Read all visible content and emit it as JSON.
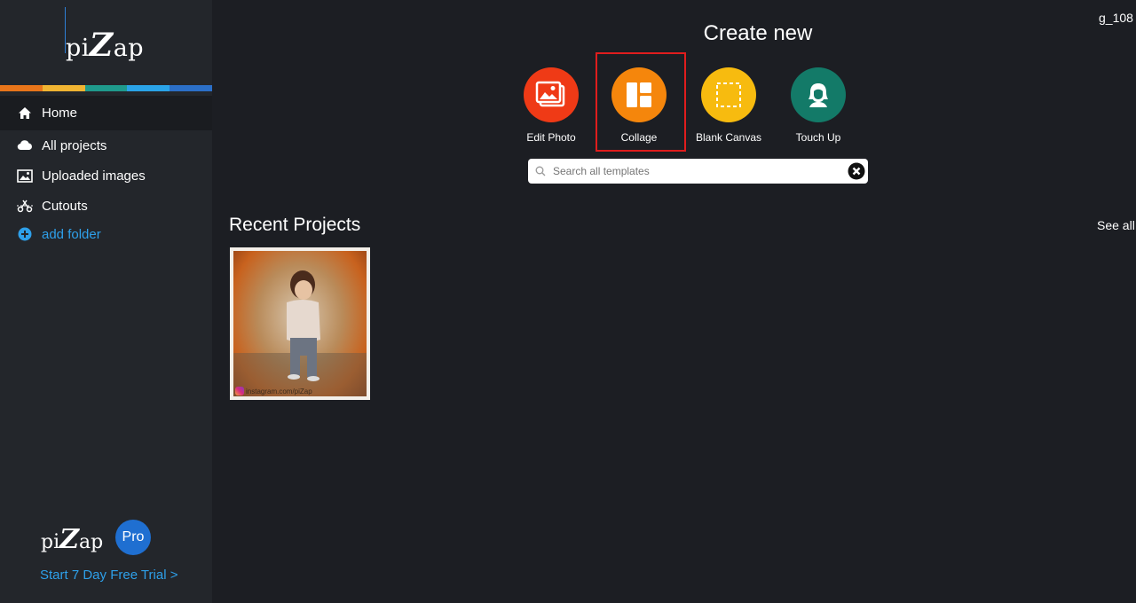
{
  "sidebar": {
    "logo": {
      "pre": "pi",
      "z": "Z",
      "post": "ap"
    },
    "stripe_colors": [
      "#e8751a",
      "#f0b432",
      "#1f9a8c",
      "#2aa3e8",
      "#2b6fc7"
    ],
    "items": [
      {
        "label": "Home",
        "icon": "home-icon"
      },
      {
        "label": "All projects",
        "icon": "cloud-icon"
      },
      {
        "label": "Uploaded images",
        "icon": "image-icon"
      },
      {
        "label": "Cutouts",
        "icon": "scissors-icon"
      },
      {
        "label": "add folder",
        "icon": "plus-circle-icon"
      }
    ],
    "pro": {
      "pre": "pi",
      "z": "Z",
      "post": "ap",
      "badge": "Pro",
      "trial_link": "Start 7 Day Free Trial >"
    }
  },
  "header": {
    "user": "g_108",
    "create_title": "Create new"
  },
  "create_options": [
    {
      "label": "Edit Photo",
      "color": "#ef3a16",
      "icon": "edit-photo-icon"
    },
    {
      "label": "Collage",
      "color": "#f5860c",
      "icon": "collage-icon"
    },
    {
      "label": "Blank Canvas",
      "color": "#f7bb0f",
      "icon": "blank-canvas-icon"
    },
    {
      "label": "Touch Up",
      "color": "#137a68",
      "icon": "touch-up-icon"
    }
  ],
  "search": {
    "placeholder": "Search all templates"
  },
  "recent": {
    "title": "Recent Projects",
    "see_all": "See all",
    "projects": [
      {
        "watermark": "instagram.com/piZap"
      }
    ]
  },
  "colors": {
    "background": "#1c1e23",
    "sidebar": "#23262b",
    "accent": "#2ea0ea",
    "highlight": "#e01d1d"
  }
}
